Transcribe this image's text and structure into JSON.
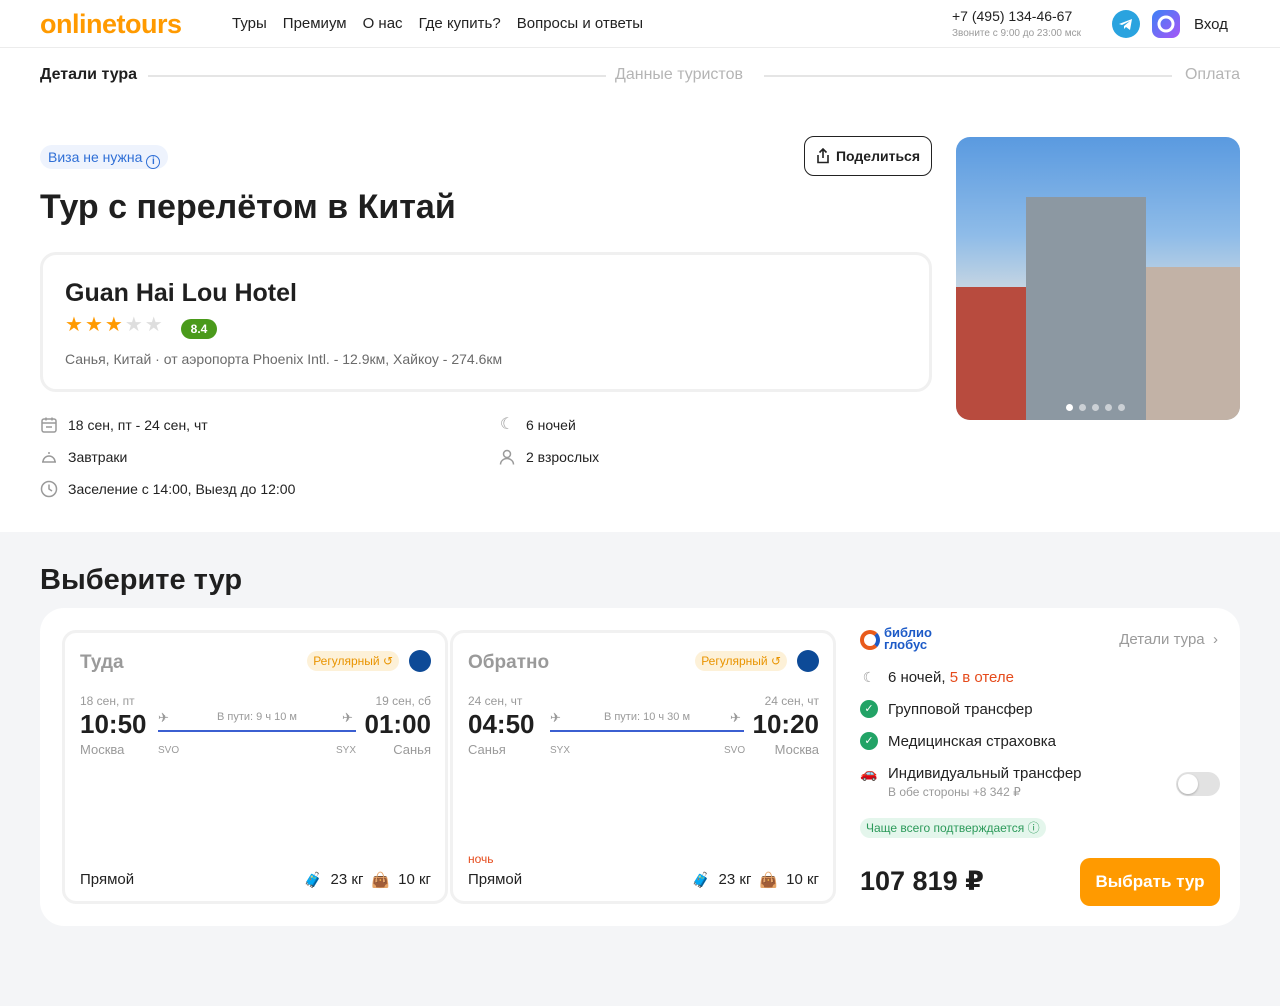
{
  "header": {
    "logo": "onlinetours",
    "nav": [
      "Туры",
      "Премиум",
      "О нас",
      "Где купить?",
      "Вопросы и ответы"
    ],
    "phone": "+7 (495) 134-46-67",
    "phone_hours": "Звоните с 9:00 до 23:00 мск",
    "login": "Вход"
  },
  "steps": [
    "Детали тура",
    "Данные туристов",
    "Оплата"
  ],
  "tour": {
    "visa_badge": "Виза не нужна",
    "share_label": "Поделиться",
    "title": "Тур с перелётом в Китай",
    "hotel": {
      "name": "Guan Hai Lou Hotel",
      "stars": 3,
      "rating": "8.4",
      "location": "Санья, Китай · от аэропорта Phoenix Intl. - 12.9км, Хайкоу - 274.6км"
    },
    "info": {
      "dates": "18 сен, пт - 24 сен, чт",
      "nights": "6 ночей",
      "meal": "Завтраки",
      "guests": "2 взрослых",
      "checkin": "Заселение с 14:00, Выезд до 12:00"
    },
    "photo_count": 5,
    "photo_active": 1
  },
  "choose": {
    "title": "Выберите тур",
    "there": {
      "title": "Туда",
      "regular": "Регулярный",
      "dep_date": "18 сен, пт",
      "dep_time": "10:50",
      "dep_city": "Москва",
      "dep_code": "SVO",
      "duration": "В пути: 9 ч 10 м",
      "arr_date": "19 сен, сб",
      "arr_time": "01:00",
      "arr_city": "Санья",
      "arr_code": "SYX",
      "type": "Прямой",
      "bag": "23 кг",
      "hand": "10 кг"
    },
    "back": {
      "title": "Обратно",
      "regular": "Регулярный",
      "dep_date": "24 сен, чт",
      "dep_time": "04:50",
      "dep_city": "Санья",
      "dep_code": "SYX",
      "duration": "В пути: 10 ч 30 м",
      "arr_date": "24 сен, чт",
      "arr_time": "10:20",
      "arr_city": "Москва",
      "arr_code": "SVO",
      "night": "ночь",
      "type": "Прямой",
      "bag": "23 кг",
      "hand": "10 кг"
    },
    "operator": {
      "name_line1": "библио",
      "name_line2": "глобус",
      "details": "Детали тура"
    },
    "features": {
      "nights": "6 ночей,",
      "in_hotel": "5 в отеле",
      "group_transfer": "Групповой трансфер",
      "insurance": "Медицинская страховка",
      "individual_transfer": "Индивидуальный трансфер",
      "individual_price": "В обе стороны +8 342 ₽",
      "individual_enabled": false
    },
    "confirm_badge": "Чаще всего подтверждается",
    "price": "107 819 ₽",
    "choose_button": "Выбрать тур"
  }
}
